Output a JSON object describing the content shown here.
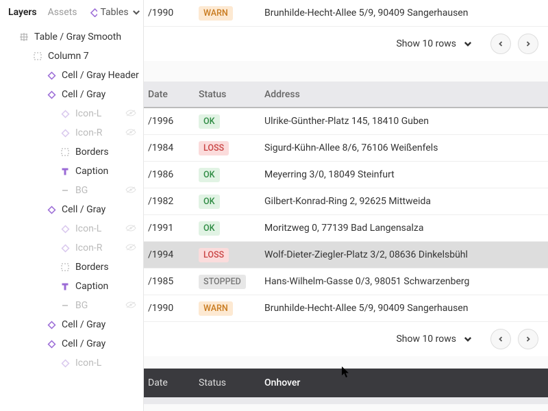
{
  "tabs": {
    "layers": "Layers",
    "assets": "Assets",
    "tables": "Tables"
  },
  "sidebar": [
    {
      "icon": "grid",
      "label": "Table / Gray Smooth",
      "ind": 0
    },
    {
      "icon": "frame",
      "label": "Column 7",
      "ind": 1
    },
    {
      "icon": "diamond",
      "label": "Cell / Gray Header",
      "ind": 2
    },
    {
      "icon": "diamond",
      "label": "Cell / Gray",
      "ind": 2
    },
    {
      "icon": "diamond",
      "label": "Icon-L",
      "ind": 3,
      "dim": true,
      "eye": true
    },
    {
      "icon": "diamond",
      "label": "Icon-R",
      "ind": 3,
      "dim": true,
      "eye": true
    },
    {
      "icon": "frame",
      "label": "Borders",
      "ind": 3
    },
    {
      "icon": "text",
      "label": "Caption",
      "ind": 3
    },
    {
      "icon": "dash",
      "label": "BG",
      "ind": 3,
      "dim": true,
      "eye": true
    },
    {
      "icon": "diamond",
      "label": "Cell / Gray",
      "ind": 2
    },
    {
      "icon": "diamond",
      "label": "Icon-L",
      "ind": 3,
      "dim": true,
      "eye": true
    },
    {
      "icon": "diamond",
      "label": "Icon-R",
      "ind": 3,
      "dim": true,
      "eye": true
    },
    {
      "icon": "frame",
      "label": "Borders",
      "ind": 3
    },
    {
      "icon": "text",
      "label": "Caption",
      "ind": 3
    },
    {
      "icon": "dash",
      "label": "BG",
      "ind": 3,
      "dim": true,
      "eye": true
    },
    {
      "icon": "diamond",
      "label": "Cell / Gray",
      "ind": 2
    },
    {
      "icon": "diamond",
      "label": "Cell / Gray",
      "ind": 2
    },
    {
      "icon": "diamond",
      "label": "Icon-L",
      "ind": 3,
      "dim": true
    }
  ],
  "headers": {
    "date": "Date",
    "status": "Status",
    "address": "Address",
    "onhover": "Onhover"
  },
  "topRow": {
    "date": "/1990",
    "status": "WARN",
    "addr": "Brunhilde-Hecht-Allee 5/9, 90409 Sangerhausen"
  },
  "rows": [
    {
      "date": "/1996",
      "status": "OK",
      "addr": "Ulrike-Günther-Platz 145, 18410 Guben"
    },
    {
      "date": "/1984",
      "status": "LOSS",
      "addr": "Sigurd-Kühn-Allee 8/6, 76106 Weißenfels"
    },
    {
      "date": "/1986",
      "status": "OK",
      "addr": "Meyerring 3/0, 18049 Steinfurt"
    },
    {
      "date": "/1982",
      "status": "OK",
      "addr": "Gilbert-Konrad-Ring 2, 92625 Mittweida"
    },
    {
      "date": "/1991",
      "status": "OK",
      "addr": "Moritzweg 0, 77139 Bad Langensalza"
    },
    {
      "date": "/1994",
      "status": "LOSS",
      "addr": "Wolf-Dieter-Ziegler-Platz 3/2, 08636 Dinkelsbühl",
      "sel": true
    },
    {
      "date": "/1985",
      "status": "STOPPED",
      "addr": "Hans-Wilhelm-Gasse 0/3, 98051 Schwarzenberg"
    },
    {
      "date": "/1990",
      "status": "WARN",
      "addr": "Brunhilde-Hecht-Allee 5/9, 90409 Sangerhausen"
    }
  ],
  "pager": {
    "label": "Show 10 rows"
  },
  "badgeClass": {
    "OK": "b-ok",
    "WARN": "b-warn",
    "LOSS": "b-loss",
    "STOPPED": "b-stopped"
  }
}
